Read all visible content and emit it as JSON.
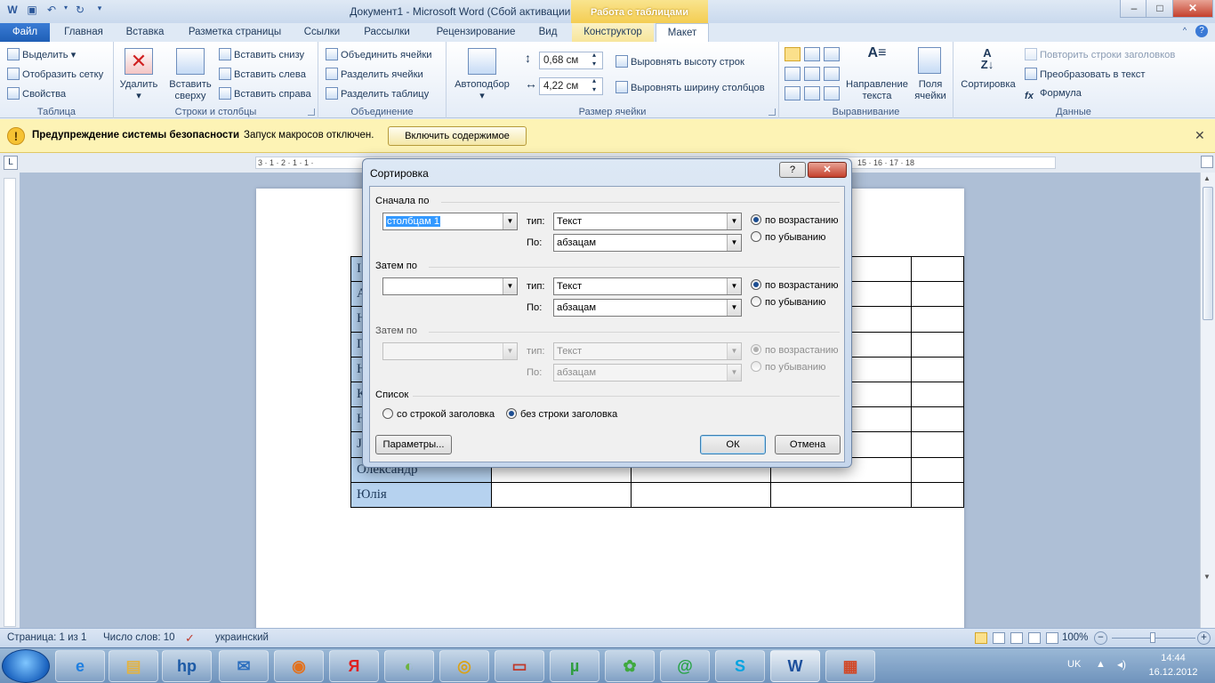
{
  "window": {
    "title": "Документ1  -  Microsoft Word (Сбой активации продукта)",
    "context_tab_header": "Работа с таблицами",
    "controls": {
      "minimize": "–",
      "maximize": "□",
      "close": "✕"
    }
  },
  "tabs": [
    {
      "label": "Файл"
    },
    {
      "label": "Главная"
    },
    {
      "label": "Вставка"
    },
    {
      "label": "Разметка страницы"
    },
    {
      "label": "Ссылки"
    },
    {
      "label": "Рассылки"
    },
    {
      "label": "Рецензирование"
    },
    {
      "label": "Вид"
    },
    {
      "label": "Конструктор"
    },
    {
      "label": "Макет"
    }
  ],
  "ribbon": {
    "table_group": {
      "label": "Таблица",
      "select": "Выделить",
      "show_grid": "Отобразить сетку",
      "properties": "Свойства"
    },
    "rows_cols_group": {
      "label": "Строки и столбцы",
      "delete": "Удалить",
      "insert_above_1": "Вставить",
      "insert_above_2": "сверху",
      "insert_below": "Вставить снизу",
      "insert_left": "Вставить слева",
      "insert_right": "Вставить справа"
    },
    "merge_group": {
      "label": "Объединение",
      "merge": "Объединить ячейки",
      "split_cells": "Разделить ячейки",
      "split_table": "Разделить таблицу"
    },
    "cell_size_group": {
      "label": "Размер ячейки",
      "autofit": "Автоподбор",
      "height_value": "0,68 см",
      "width_value": "4,22 см",
      "distribute_rows": "Выровнять высоту строк",
      "distribute_cols": "Выровнять ширину столбцов"
    },
    "alignment_group": {
      "label": "Выравнивание",
      "text_direction_1": "Направление",
      "text_direction_2": "текста",
      "margins_1": "Поля",
      "margins_2": "ячейки"
    },
    "data_group": {
      "label": "Данные",
      "sort": "Сортировка",
      "repeat_headers": "Повторить строки заголовков",
      "convert": "Преобразовать в текст",
      "formula": "Формула"
    }
  },
  "message_bar": {
    "title": "Предупреждение системы безопасности",
    "text": "Запуск макросов отключен.",
    "button": "Включить содержимое"
  },
  "ruler": {
    "left_marks": "3 · 1 · 2 · 1 · 1 ·",
    "right_marks": "15 · 16 ·  17 · 18"
  },
  "document": {
    "rows": [
      {
        "first": "",
        "partial": "І"
      },
      {
        "first": "",
        "partial": "А"
      },
      {
        "first": "",
        "partial": "Н"
      },
      {
        "first": "",
        "partial": "П"
      },
      {
        "first": "",
        "partial": "Н"
      },
      {
        "first": "",
        "partial": "К"
      },
      {
        "first": "",
        "partial": "Н"
      },
      {
        "first": "",
        "partial": "Ј"
      },
      {
        "first": "Олександр",
        "partial": ""
      },
      {
        "first": "Юлія",
        "partial": ""
      }
    ]
  },
  "dialog": {
    "title": "Сортировка",
    "help": "?",
    "close": "✕",
    "first_by": {
      "label": "Сначала по",
      "column": "столбцам 1",
      "type_label": "тип:",
      "type_value": "Текст",
      "by_label": "По:",
      "by_value": "абзацам",
      "asc": "по возрастанию",
      "desc": "по убыванию"
    },
    "then_by": {
      "label": "Затем по",
      "column": "",
      "type_label": "тип:",
      "type_value": "Текст",
      "by_label": "По:",
      "by_value": "абзацам",
      "asc": "по возрастанию",
      "desc": "по убыванию"
    },
    "then_by_2": {
      "label": "Затем по",
      "column": "",
      "type_label": "тип:",
      "type_value": "Текст",
      "by_label": "По:",
      "by_value": "абзацам",
      "asc": "по возрастанию",
      "desc": "по убыванию"
    },
    "list": {
      "label": "Список",
      "with_header": "со строкой заголовка",
      "without_header": "без строки заголовка"
    },
    "options_button": "Параметры...",
    "ok_button": "ОК",
    "cancel_button": "Отмена"
  },
  "status_bar": {
    "page": "Страница: 1 из 1",
    "words": "Число слов: 10",
    "language": "украинский",
    "zoom": "100%"
  },
  "taskbar": {
    "lang": "UK",
    "time": "14:44",
    "date": "16.12.2012"
  },
  "colors": {
    "selected_cell": "#b6d2ef",
    "message_bar": "#fdf3b5",
    "file_tab": "#2b65c0"
  }
}
